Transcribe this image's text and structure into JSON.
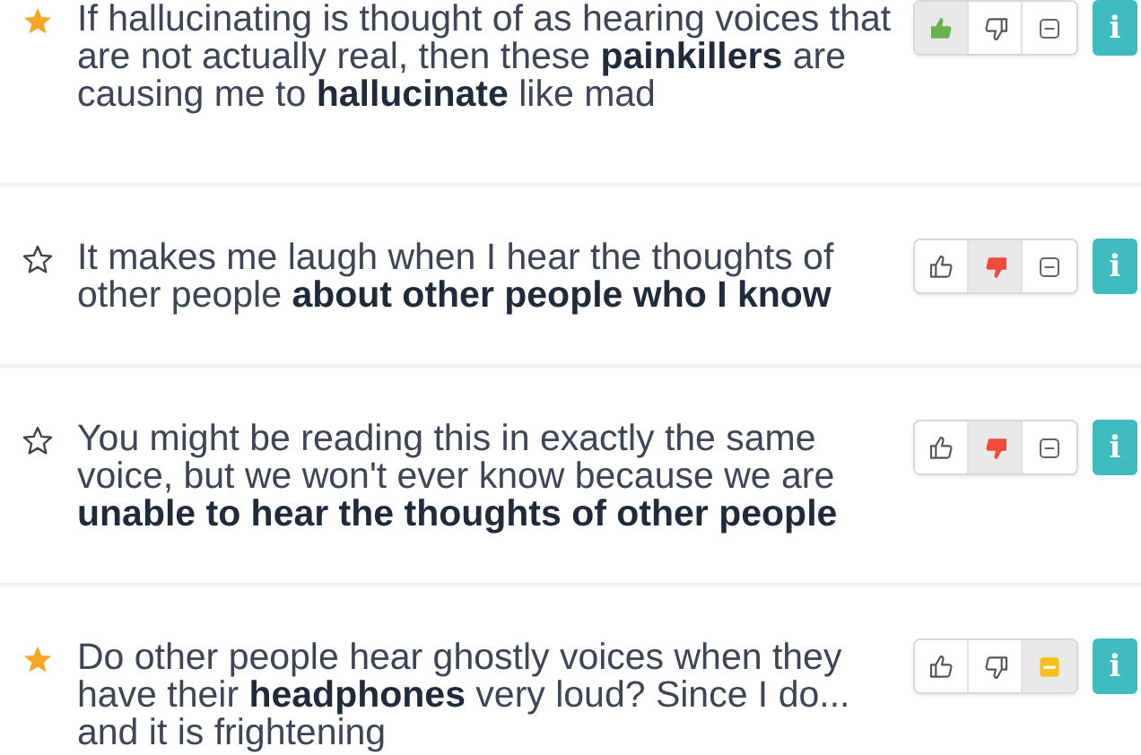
{
  "items": [
    {
      "starred": true,
      "text": "If hallucinating is thought of as hearing voices that are not actually real, then these **painkillers** are causing me to **hallucinate** like mad",
      "votes": [
        {
          "kind": "up",
          "selected": true
        },
        {
          "kind": "down",
          "selected": false
        },
        {
          "kind": "neutral",
          "selected": false
        }
      ],
      "info": "i"
    },
    {
      "starred": false,
      "text": "It makes me laugh when I hear the thoughts of other people **about other people who I know**",
      "votes": [
        {
          "kind": "up",
          "selected": false
        },
        {
          "kind": "down",
          "selected": true
        },
        {
          "kind": "neutral",
          "selected": false
        }
      ],
      "info": "i"
    },
    {
      "starred": false,
      "text": "You might be reading this in exactly the same voice, but we won't ever know because we are **unable to hear the thoughts of other people**",
      "votes": [
        {
          "kind": "up",
          "selected": false
        },
        {
          "kind": "down",
          "selected": true
        },
        {
          "kind": "neutral",
          "selected": false
        }
      ],
      "info": "i"
    },
    {
      "starred": true,
      "text": "Do other people hear ghostly voices when they have their **headphones** very loud? Since I do... and it is frightening",
      "votes": [
        {
          "kind": "up",
          "selected": false
        },
        {
          "kind": "down",
          "selected": false
        },
        {
          "kind": "neutral",
          "selected": true
        }
      ],
      "info": "i"
    }
  ]
}
